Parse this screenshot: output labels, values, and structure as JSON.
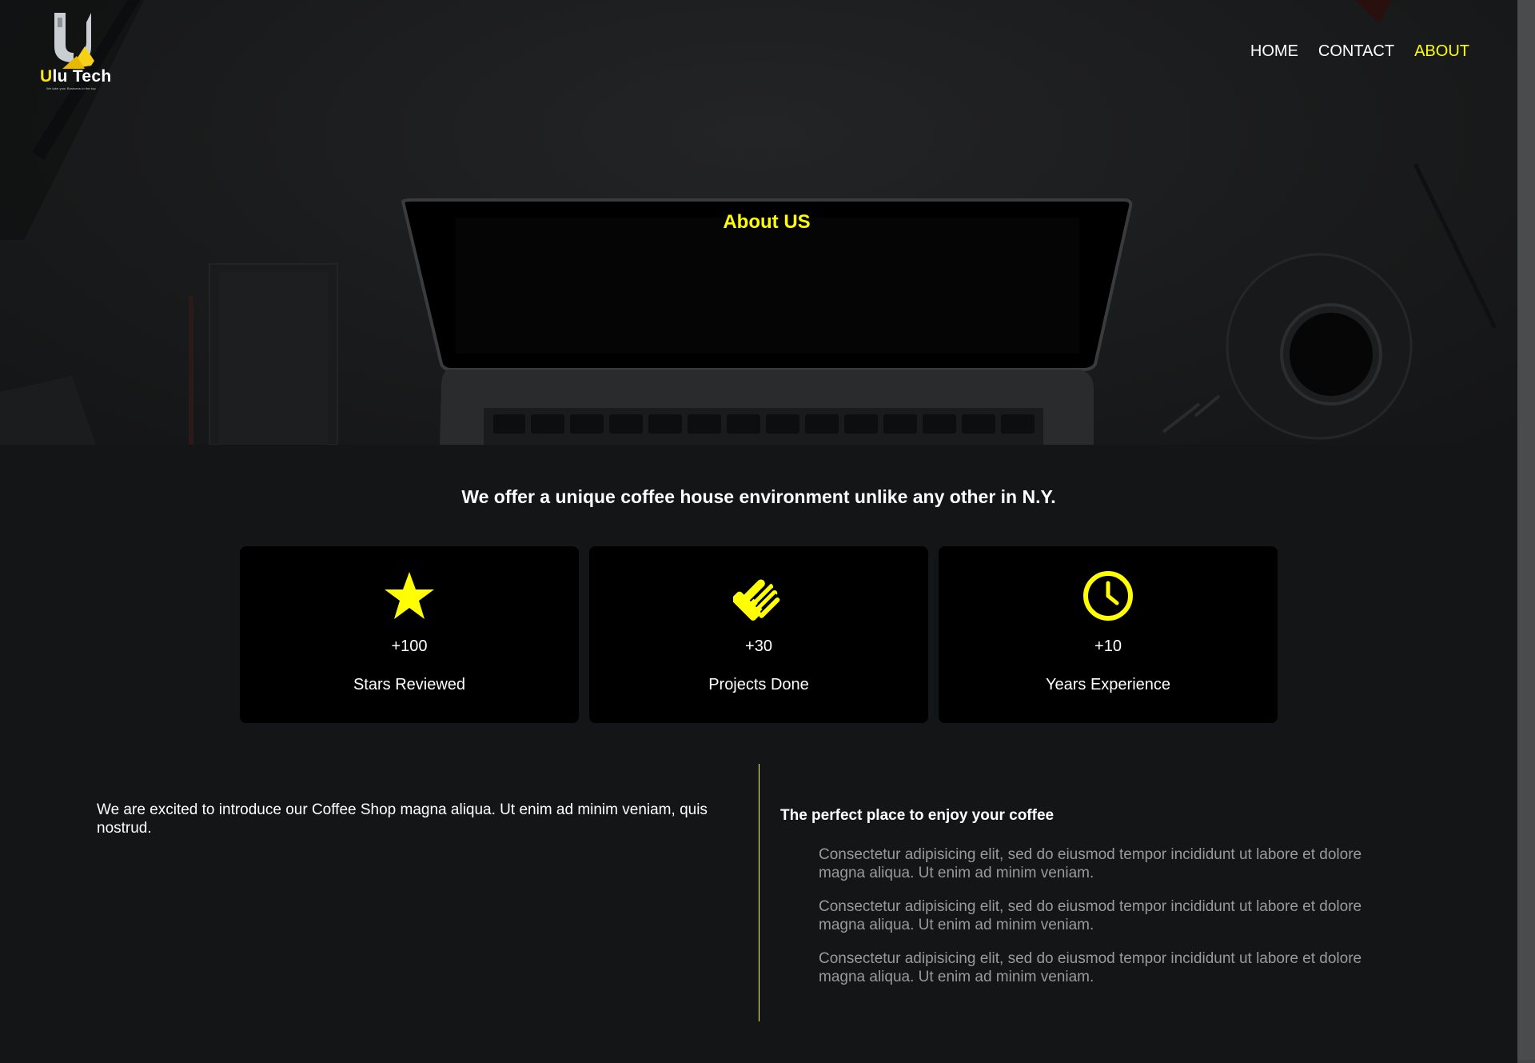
{
  "logo": {
    "brand_first": "U",
    "brand_rest": "lu Tech",
    "tagline": "We take your Business to the top"
  },
  "nav": {
    "items": [
      {
        "label": "HOME",
        "active": false
      },
      {
        "label": "CONTACT",
        "active": false
      },
      {
        "label": "ABOUT",
        "active": true
      }
    ]
  },
  "hero": {
    "title": "About US"
  },
  "offer": {
    "heading": "We offer a unique coffee house environment unlike any other in N.Y.",
    "cards": [
      {
        "icon": "star-icon",
        "value": "+100",
        "label": "Stars Reviewed"
      },
      {
        "icon": "handshake-icon",
        "value": "+30",
        "label": "Projects Done"
      },
      {
        "icon": "clock-icon",
        "value": "+10",
        "label": "Years Experience"
      }
    ]
  },
  "about": {
    "intro": "We are excited to introduce our Coffee Shop magna aliqua. Ut enim ad minim veniam, quis nostrud.",
    "perfect_title": "The perfect place to enjoy your coffee",
    "paragraphs": [
      "Consectetur adipisicing elit, sed do eiusmod tempor incididunt ut labore et dolore magna aliqua. Ut enim ad minim veniam.",
      "Consectetur adipisicing elit, sed do eiusmod tempor incididunt ut labore et dolore magna aliqua. Ut enim ad minim veniam.",
      "Consectetur adipisicing elit, sed do eiusmod tempor incididunt ut labore et dolore magna aliqua. Ut enim ad minim veniam."
    ]
  },
  "colors": {
    "accent": "#ffff00",
    "background": "#141516",
    "card": "#000000",
    "muted_text": "#9a9a9a"
  }
}
